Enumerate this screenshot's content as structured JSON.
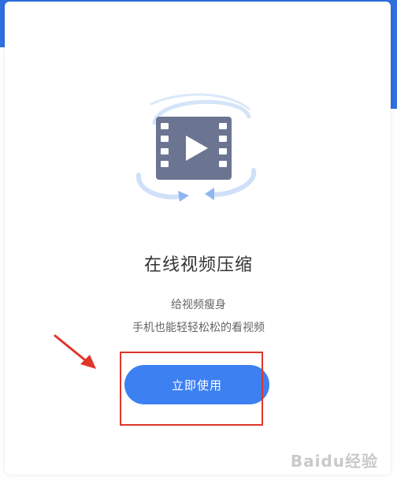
{
  "feature": {
    "title": "在线视频压缩",
    "line1": "给视频瘦身",
    "line2": "手机也能轻轻松松的看视频",
    "button_label": "立即使用",
    "icon": "video-compress-icon"
  },
  "watermark": {
    "text": "Baidu经验"
  },
  "colors": {
    "header_blue": "#2f6fe0",
    "button_blue": "#3d80f2",
    "annotation_red": "#e0352b",
    "icon_gray": "#6b7592"
  }
}
